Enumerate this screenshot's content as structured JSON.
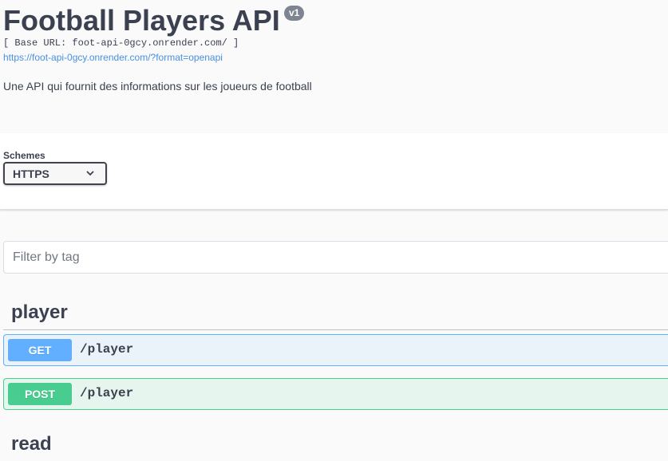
{
  "info": {
    "title": "Football Players API",
    "version": "v1",
    "base_url": "[ Base URL: foot-api-0gcy.onrender.com/ ]",
    "spec_link": "https://foot-api-0gcy.onrender.com/?format=openapi",
    "description": "Une API qui fournit des informations sur les joueurs de football"
  },
  "schemes": {
    "label": "Schemes",
    "selected": "HTTPS"
  },
  "filter": {
    "placeholder": "Filter by tag"
  },
  "tags": [
    {
      "name": "player",
      "operations": [
        {
          "method": "GET",
          "path": "/player",
          "color": "#61affe"
        },
        {
          "method": "POST",
          "path": "/player",
          "color": "#49cc90"
        }
      ]
    },
    {
      "name": "read"
    }
  ]
}
